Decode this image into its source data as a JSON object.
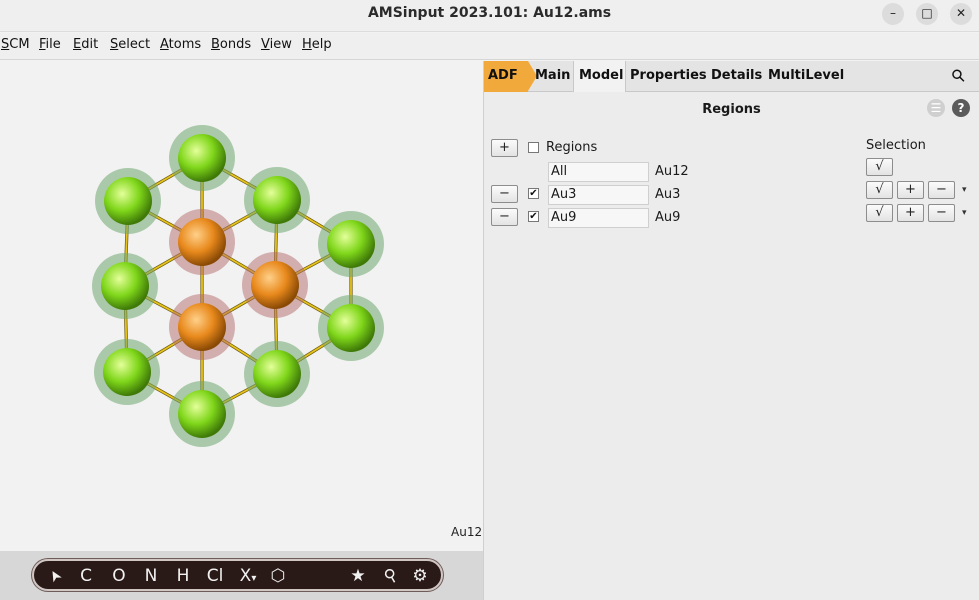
{
  "window": {
    "title": "AMSinput 2023.101: Au12.ams",
    "minimize_glyph": "–",
    "maximize_glyph": "□",
    "close_glyph": "✕"
  },
  "menu": [
    {
      "u": "S",
      "rest": "CM"
    },
    {
      "u": "F",
      "rest": "ile"
    },
    {
      "u": "E",
      "rest": "dit"
    },
    {
      "u": "S",
      "rest": "elect"
    },
    {
      "u": "A",
      "rest": "toms"
    },
    {
      "u": "B",
      "rest": "onds"
    },
    {
      "u": "V",
      "rest": "iew"
    },
    {
      "u": "H",
      "rest": "elp"
    }
  ],
  "viewer": {
    "molecule_label": "Au12",
    "atom_colors": {
      "region_au9": "#7fd61a",
      "region_au3": "#e8891c",
      "bond": "#e6c21a"
    }
  },
  "toolbar": {
    "pointer": "➤",
    "c": "C",
    "o": "O",
    "n": "N",
    "h": "H",
    "cl": "Cl",
    "x": "X",
    "x_sub": "▾",
    "ring_icon": "⬡",
    "star_icon": "★",
    "wand_icon": "⚲",
    "gear_icon": "⚙"
  },
  "tabs": {
    "adf": "ADF",
    "main": "Main",
    "model": "Model",
    "properties": "Properties",
    "details": "Details",
    "multilevel": "MultiLevel"
  },
  "panel": {
    "title": "Regions",
    "list_icon": "☰",
    "help_icon": "?",
    "search_icon": "⚲",
    "regions_header": "Regions",
    "selection_header": "Selection",
    "add_glyph": "+",
    "remove_glyph": "−",
    "check_glyph": "√",
    "checked_glyph": "✔",
    "dropdown_glyph": "▾",
    "all_row": {
      "name": "All",
      "atoms": "Au12"
    },
    "rows": [
      {
        "name": "Au3",
        "atoms": "Au3"
      },
      {
        "name": "Au9",
        "atoms": "Au9"
      }
    ]
  }
}
